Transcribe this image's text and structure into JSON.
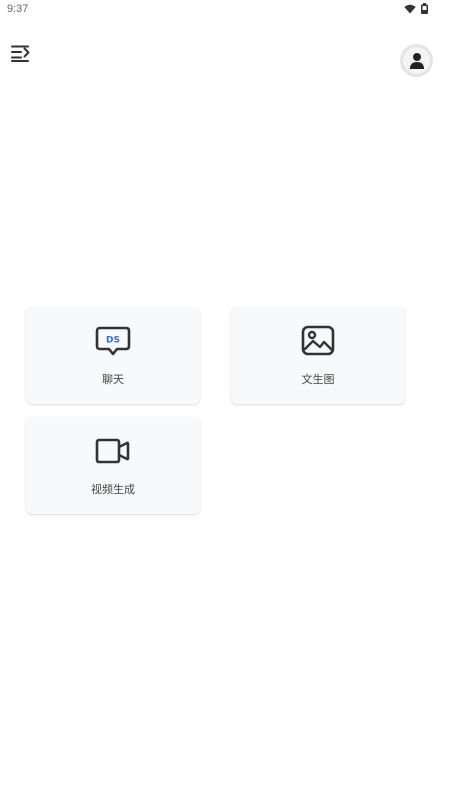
{
  "status_bar": {
    "time": "9:37",
    "icons": [
      "wifi-icon",
      "battery-icon"
    ]
  },
  "header": {
    "menu_icon": "menu-expand-icon",
    "avatar_icon": "user-avatar-icon"
  },
  "features": [
    {
      "label": "聊天",
      "icon": "chat-bubble-icon",
      "icon_text": "DS"
    },
    {
      "label": "文生图",
      "icon": "image-icon"
    },
    {
      "label": "视频生成",
      "icon": "video-camera-icon"
    }
  ],
  "colors": {
    "accent": "#2f6fd6",
    "icon": "#333333",
    "card_bg": "#f8f9fa"
  }
}
